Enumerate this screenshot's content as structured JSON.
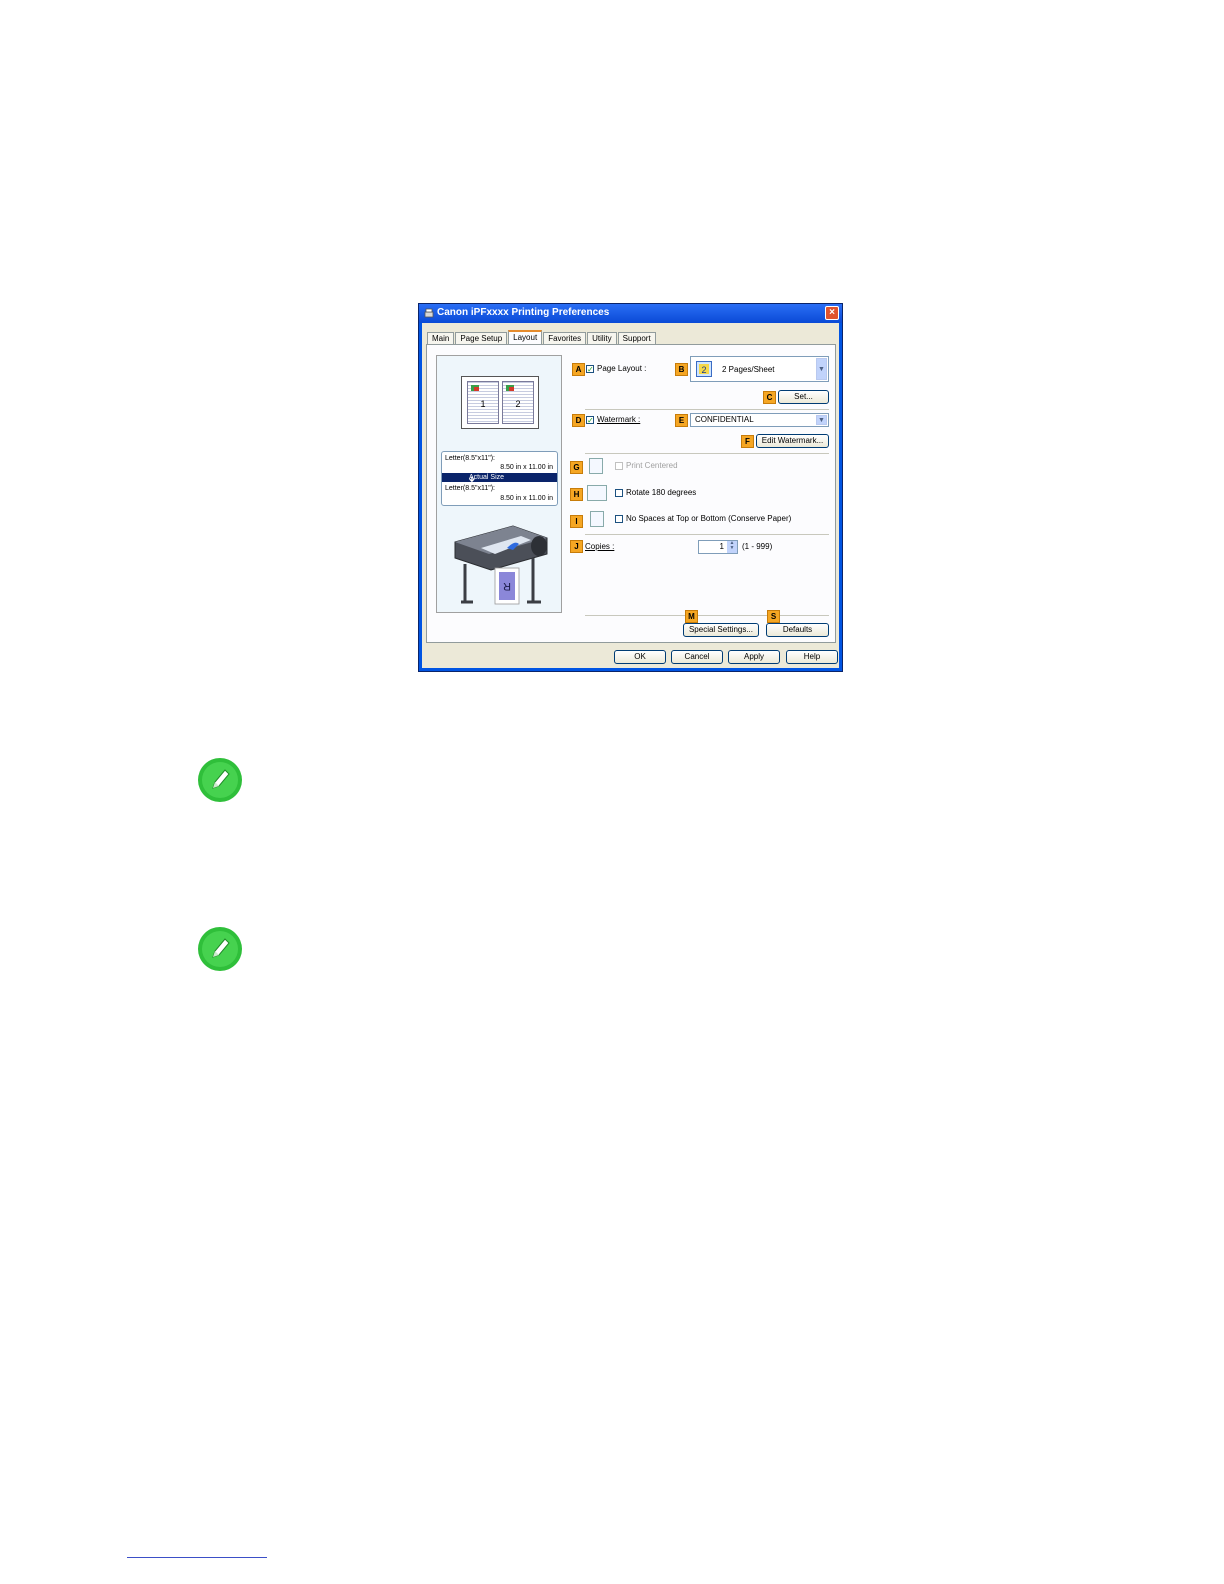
{
  "window": {
    "title": "Canon iPFxxxx Printing Preferences",
    "close_label": "×"
  },
  "tabs": [
    {
      "label": "Main"
    },
    {
      "label": "Page Setup"
    },
    {
      "label": "Layout"
    },
    {
      "label": "Favorites"
    },
    {
      "label": "Utility"
    },
    {
      "label": "Support"
    }
  ],
  "active_tab": "Layout",
  "preview": {
    "page_numbers": [
      "1",
      "2"
    ],
    "paper_size_1": "Letter(8.5\"x11\"):",
    "paper_dims_1": "8.50 in x 11.00 in",
    "scaling": "Actual Size",
    "paper_size_2": "Letter(8.5\"x11\"):",
    "paper_dims_2": "8.50 in x 11.00 in",
    "printer_sheet_letter": "R"
  },
  "badges": {
    "a": "A",
    "b": "B",
    "c": "C",
    "d": "D",
    "e": "E",
    "f": "F",
    "g": "G",
    "h": "H",
    "i": "I",
    "j": "J",
    "m": "M",
    "s": "S"
  },
  "layout": {
    "page_layout_label": "Page Layout :",
    "page_layout_checked": true,
    "pages_per_sheet": "2 Pages/Sheet",
    "pages_per_sheet_icon_digit": "2",
    "set_button": "Set..."
  },
  "watermark": {
    "label": "Watermark :",
    "checked": true,
    "value": "CONFIDENTIAL",
    "edit_button": "Edit Watermark..."
  },
  "options": {
    "print_centered": "Print Centered",
    "print_centered_enabled": false,
    "rotate": "Rotate 180 degrees",
    "rotate_checked": false,
    "no_spaces": "No Spaces at Top or Bottom (Conserve Paper)",
    "no_spaces_checked": false
  },
  "copies": {
    "label": "Copies :",
    "value": "1",
    "range": "(1 - 999)"
  },
  "bottom_buttons": {
    "special_settings": "Special Settings...",
    "defaults": "Defaults"
  },
  "dialog_buttons": {
    "ok": "OK",
    "cancel": "Cancel",
    "apply": "Apply",
    "help": "Help"
  },
  "colors": {
    "title_bar": "#0a4ad6",
    "badge": "#f5a623",
    "selection": "#0a246a",
    "note_icon": "#2fbf3a"
  },
  "icons": [
    "printer-icon",
    "note-pencil-icon",
    "close-icon",
    "dropdown-arrow-icon"
  ]
}
